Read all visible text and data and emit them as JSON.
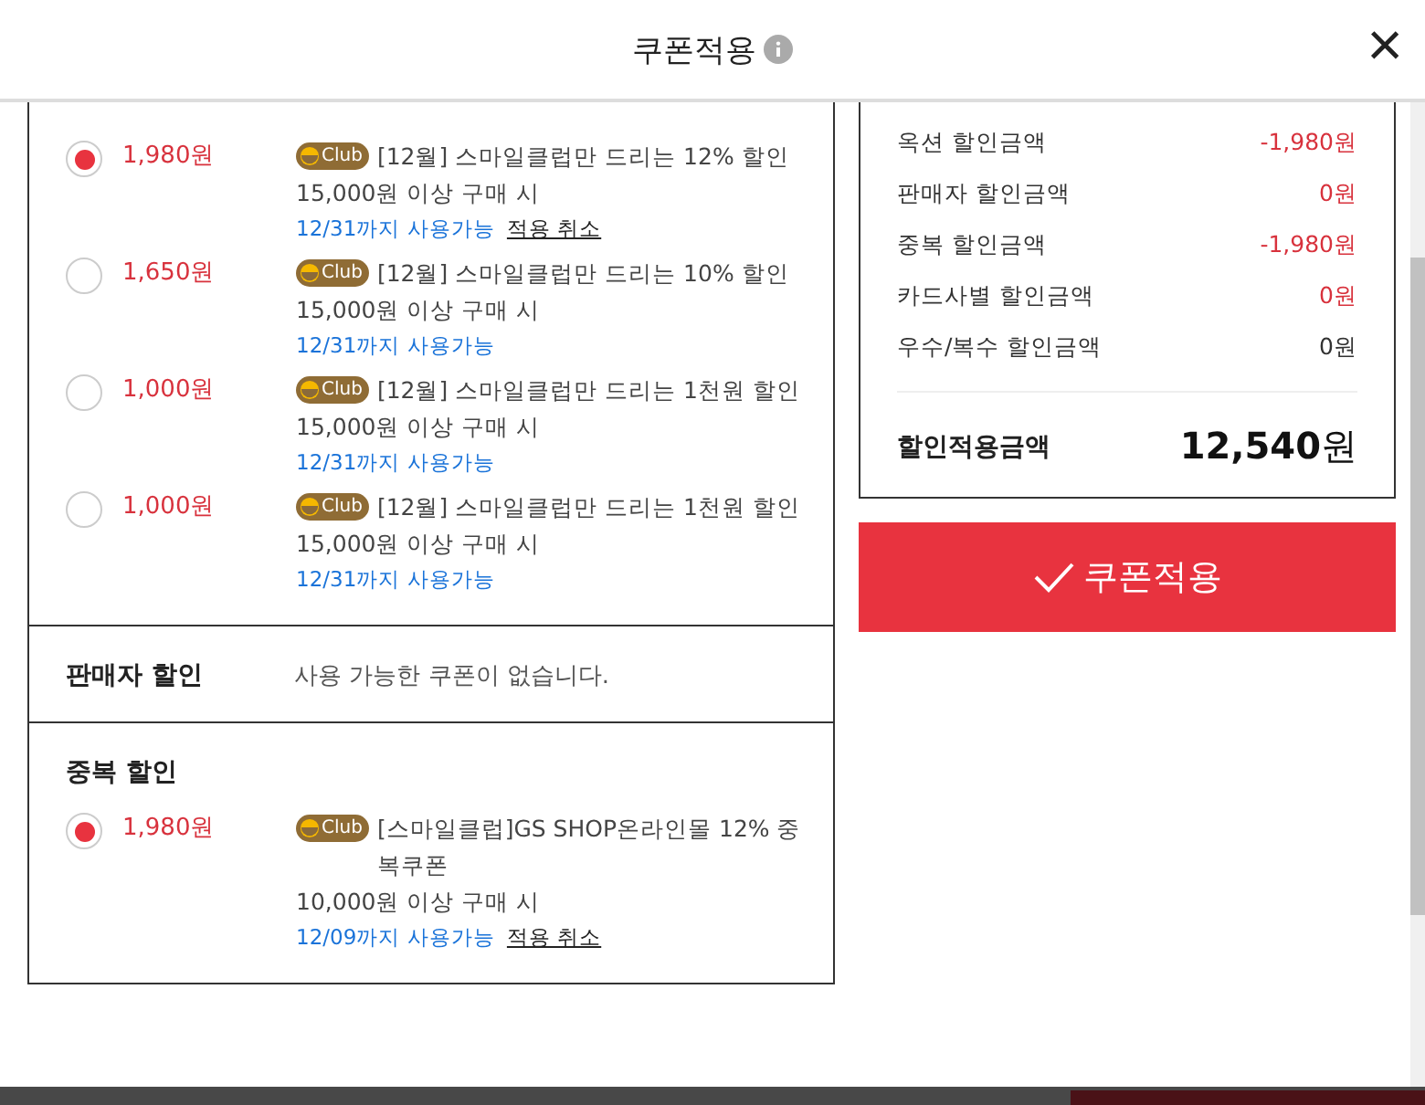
{
  "dialog": {
    "title": "쿠폰적용",
    "close_label": "×"
  },
  "sections": [
    {
      "kind": "coupons",
      "coupons": [
        {
          "selected": true,
          "amount": "1,980원",
          "badge": "Club",
          "name": "[12월] 스마일클럽만 드리는 12% 할인",
          "condition": "15,000원 이상 구매 시",
          "validity": "12/31까지 사용가능",
          "cancel": "적용 취소"
        },
        {
          "selected": false,
          "amount": "1,650원",
          "badge": "Club",
          "name": "[12월] 스마일클럽만 드리는 10% 할인",
          "condition": "15,000원 이상 구매 시",
          "validity": "12/31까지 사용가능"
        },
        {
          "selected": false,
          "amount": "1,000원",
          "badge": "Club",
          "name": "[12월] 스마일클럽만 드리는 1천원 할인",
          "condition": "15,000원 이상 구매 시",
          "validity": "12/31까지 사용가능"
        },
        {
          "selected": false,
          "amount": "1,000원",
          "badge": "Club",
          "name": "[12월] 스마일클럽만 드리는 1천원 할인",
          "condition": "15,000원 이상 구매 시",
          "validity": "12/31까지 사용가능"
        }
      ]
    },
    {
      "kind": "empty",
      "title": "판매자 할인",
      "message": "사용 가능한 쿠폰이 없습니다."
    },
    {
      "kind": "coupons",
      "title": "중복 할인",
      "coupons": [
        {
          "selected": true,
          "amount": "1,980원",
          "badge": "Club",
          "name": "[스마일클럽]GS SHOP온라인몰 12% 중복쿠폰",
          "condition": "10,000원 이상 구매 시",
          "validity": "12/09까지 사용가능",
          "cancel": "적용 취소"
        }
      ]
    }
  ],
  "summary": {
    "rows": [
      {
        "label": "옥션 할인금액",
        "value": "-1,980원",
        "highlight": true
      },
      {
        "label": "판매자 할인금액",
        "value": "0원",
        "highlight": true
      },
      {
        "label": "중복 할인금액",
        "value": "-1,980원",
        "highlight": true
      },
      {
        "label": "카드사별 할인금액",
        "value": "0원",
        "highlight": true
      },
      {
        "label": "우수/복수 할인금액",
        "value": "0원",
        "highlight": false
      }
    ],
    "total_label": "할인적용금액",
    "total_value": "12,540",
    "total_unit": "원"
  },
  "apply_button": "쿠폰적용"
}
